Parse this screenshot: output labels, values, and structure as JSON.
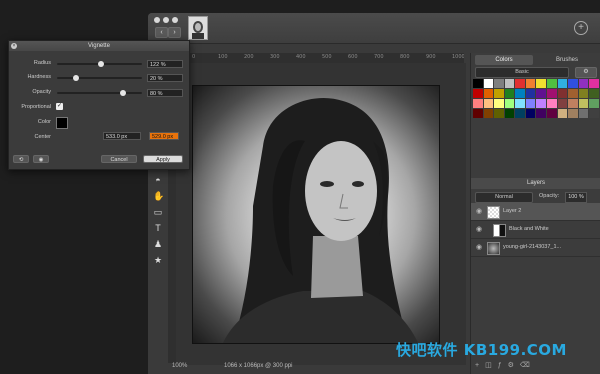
{
  "dialog": {
    "title": "Vignette",
    "params": [
      {
        "label": "Radius",
        "value": "122 %",
        "level": 0.52
      },
      {
        "label": "Hardness",
        "value": "20 %",
        "level": 0.2
      },
      {
        "label": "Opacity",
        "value": "80 %",
        "level": 0.8
      }
    ],
    "proportional_label": "Proportional",
    "proportional_checked": true,
    "color_label": "Color",
    "color_value": "#000000",
    "center_label": "Center",
    "center_x": "533.0 px",
    "center_y": "529.0 px",
    "cancel_label": "Cancel",
    "apply_label": "Apply"
  },
  "ruler": {
    "ticks": [
      "0",
      "100",
      "200",
      "300",
      "400",
      "500",
      "600",
      "700",
      "800",
      "900",
      "1000"
    ]
  },
  "status": {
    "zoom": "100%",
    "doc_info": "1066 x 1066px @ 300 ppi"
  },
  "panel": {
    "tabs": [
      "Colors",
      "Brushes"
    ],
    "swatch_set": "Basic",
    "swatches": [
      "#000000",
      "#ffffff",
      "#7f7f7f",
      "#bfbfbf",
      "#e03030",
      "#f08030",
      "#f0e030",
      "#50c040",
      "#30b0e0",
      "#3050e0",
      "#9030c0",
      "#e030a0",
      "#c00000",
      "#e06000",
      "#c0a000",
      "#208020",
      "#0080c0",
      "#2030a0",
      "#601090",
      "#a01070",
      "#803030",
      "#a06030",
      "#808020",
      "#406020",
      "#ff8080",
      "#ffc080",
      "#ffff80",
      "#a0ff80",
      "#80e0ff",
      "#8080ff",
      "#c080ff",
      "#ff80c0",
      "#804040",
      "#c08060",
      "#c0c060",
      "#60a060",
      "#600000",
      "#804000",
      "#606000",
      "#004000",
      "#004060",
      "#000060",
      "#400060",
      "#600040",
      "#d0b080",
      "#a08060",
      "#707070",
      "#404040"
    ],
    "layers_title": "Layers",
    "blend_mode": "Normal",
    "opacity_label": "Opacity:",
    "opacity_value": "100 %",
    "layers": [
      {
        "name": "Layer 2",
        "selected": true
      },
      {
        "name": "Black and White",
        "selected": false
      },
      {
        "name": "young-girl-2143037_1...",
        "selected": false
      }
    ]
  },
  "watermark": "快吧软件 KB199.COM"
}
